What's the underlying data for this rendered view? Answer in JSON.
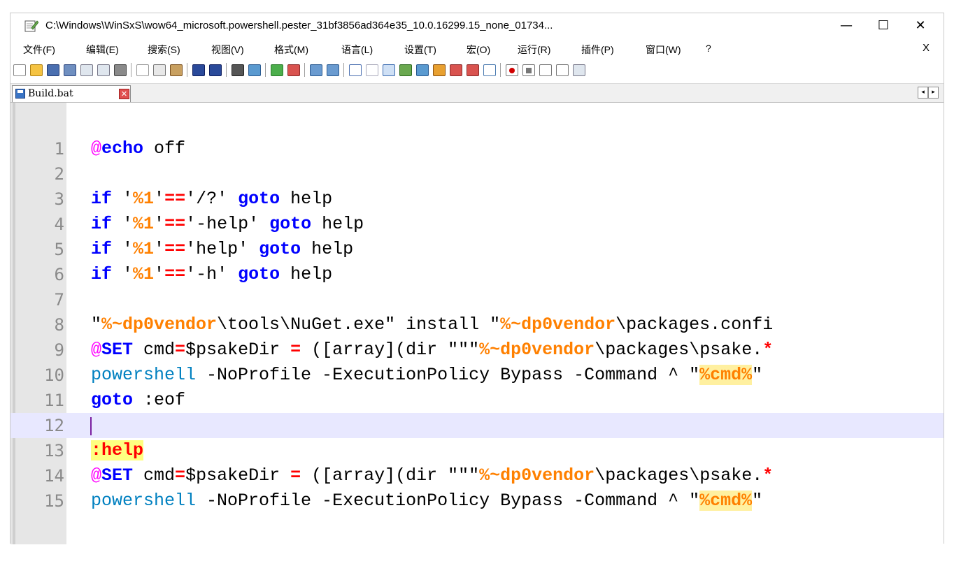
{
  "window": {
    "title": "C:\\Windows\\WinSxS\\wow64_microsoft.powershell.pester_31bf3856ad364e35_10.0.16299.15_none_01734...",
    "minimize": "—",
    "maximize": "☐",
    "close": "✕"
  },
  "menu": {
    "items": [
      "文件(F)",
      "编辑(E)",
      "搜索(S)",
      "视图(V)",
      "格式(M)",
      "语言(L)",
      "设置(T)",
      "宏(O)",
      "运行(R)",
      "插件(P)",
      "窗口(W)",
      "?"
    ],
    "close_doc": "X"
  },
  "toolbar": {
    "icons": [
      "new-file-icon",
      "open-file-icon",
      "save-icon",
      "save-all-icon",
      "close-icon",
      "close-all-icon",
      "print-icon",
      "cut-icon",
      "copy-icon",
      "paste-icon",
      "undo-icon",
      "redo-icon",
      "find-icon",
      "replace-icon",
      "zoom-in-icon",
      "zoom-out-icon",
      "sync-vertical-icon",
      "sync-horizontal-icon",
      "word-wrap-icon",
      "show-all-chars-icon",
      "indent-guide-icon",
      "user-lang-icon",
      "doc-map-icon",
      "function-list-icon",
      "folder-workspace-icon",
      "monitor-icon",
      "record-macro-icon",
      "stop-macro-icon",
      "play-macro-icon",
      "run-macro-multiple-icon",
      "save-macro-icon"
    ]
  },
  "tab": {
    "label": "Build.bat",
    "close": "✕",
    "scroll_left": "◂",
    "scroll_right": "▸"
  },
  "editor": {
    "line_numbers": [
      "1",
      "2",
      "3",
      "4",
      "5",
      "6",
      "7",
      "8",
      "9",
      "10",
      "11",
      "12",
      "13",
      "14",
      "15"
    ],
    "current_line": 12,
    "tokens": {
      "l1_at": "@",
      "l1_kw": "echo",
      "l1_rest": " off",
      "l3_kw": "if",
      "l3_a": " '",
      "l3_var": "%1",
      "l3_b": "'",
      "l3_op": "==",
      "l3_c": "'/?' ",
      "l3_kw2": "goto",
      "l3_d": " help",
      "l4_kw": "if",
      "l4_a": " '",
      "l4_var": "%1",
      "l4_b": "'",
      "l4_op": "==",
      "l4_c": "'-help' ",
      "l4_kw2": "goto",
      "l4_d": " help",
      "l5_kw": "if",
      "l5_a": " '",
      "l5_var": "%1",
      "l5_b": "'",
      "l5_op": "==",
      "l5_c": "'help' ",
      "l5_kw2": "goto",
      "l5_d": " help",
      "l6_kw": "if",
      "l6_a": " '",
      "l6_var": "%1",
      "l6_b": "'",
      "l6_op": "==",
      "l6_c": "'-h' ",
      "l6_kw2": "goto",
      "l6_d": " help",
      "l8_a": "\"",
      "l8_var": "%~dp0vendor",
      "l8_b": "\\tools\\NuGet.exe\" install \"",
      "l8_var2": "%~dp0vendor",
      "l8_c": "\\packages.confi",
      "l9_at": "@",
      "l9_kw": "SET",
      "l9_a": " cmd",
      "l9_op": "=",
      "l9_b": "$psakeDir ",
      "l9_op2": "=",
      "l9_c": " ([array](dir \"\"\"",
      "l9_var": "%~dp0vendor",
      "l9_d": "\\packages\\psake.",
      "l9_op3": "*",
      "l10_cmd": "powershell",
      "l10_a": " -NoProfile -ExecutionPolicy Bypass -Command ^ \"",
      "l10_var": "%cmd%",
      "l10_b": "\"",
      "l11_kw": "goto",
      "l11_a": " :eof",
      "l13_lbl": ":help",
      "l14_at": "@",
      "l14_kw": "SET",
      "l14_a": " cmd",
      "l14_op": "=",
      "l14_b": "$psakeDir ",
      "l14_op2": "=",
      "l14_c": " ([array](dir \"\"\"",
      "l14_var": "%~dp0vendor",
      "l14_d": "\\packages\\psake.",
      "l14_op3": "*",
      "l15_cmd": "powershell",
      "l15_a": " -NoProfile -ExecutionPolicy Bypass -Command ^ \"",
      "l15_var": "%cmd%",
      "l15_b": "\""
    }
  },
  "colors": {
    "keyword": "#0000ff",
    "at_sign": "#ff00ff",
    "variable": "#ff8000",
    "operator": "#ff0000",
    "command": "#0080c0",
    "current_line": "#e8e8ff"
  }
}
